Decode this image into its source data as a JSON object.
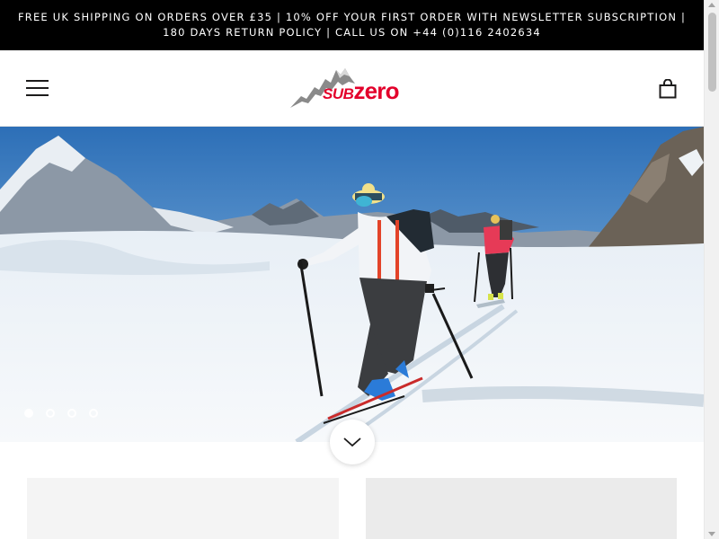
{
  "announcement": {
    "line1": "FREE UK SHIPPING ON ORDERS OVER £35 | 10% OFF YOUR FIRST ORDER WITH NEWSLETTER SUBSCRIPTION |",
    "line2": "180 DAYS RETURN POLICY | CALL US ON +44 (0)116 2402634"
  },
  "header": {
    "menu_icon": "hamburger-menu-icon",
    "logo": {
      "sub": "SUB",
      "zero": "zero"
    },
    "cart_icon": "shopping-bag-icon"
  },
  "hero": {
    "image_icon": "ski-touring-mountain-photo",
    "slides": [
      {
        "active": true
      },
      {
        "active": false
      },
      {
        "active": false
      },
      {
        "active": false
      }
    ],
    "scroll_icon": "chevron-down-icon"
  },
  "colors": {
    "brand_red": "#e3002b",
    "announcement_bg": "#000000",
    "card_left_bg": "#f4f4f4",
    "card_right_bg": "#ebebeb"
  }
}
